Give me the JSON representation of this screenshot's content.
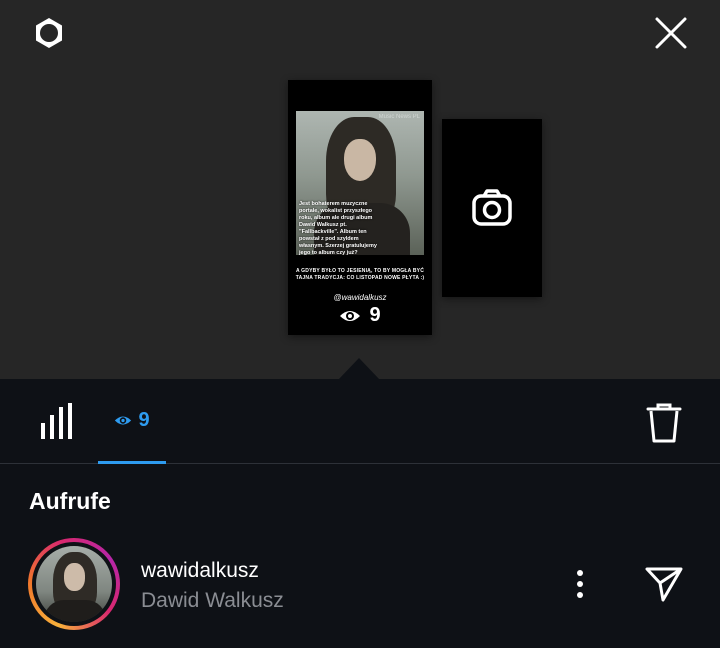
{
  "story": {
    "watermark": "Music News PL",
    "overlay_text": "Jest bohaterem muzyczne portale, wokalist przyszłego roku, album ale drugi album Dawid Walkusz pt. \"Fallbackville\". Album ten powstał z pod szyldem własnym. Szerzej gratulujemy jego to album czy już?",
    "caption": "A GDYBY BYŁO TO JESIENIĄ, TO BY MOGŁA BYĆ TAJNA TRADYCJA: CO LISTOPAD NOWE PŁYTA :)",
    "mention": "@wawidalkusz",
    "views": "9"
  },
  "tabs": {
    "viewers_count": "9"
  },
  "section_title": "Aufrufe",
  "viewer": {
    "username": "wawidalkusz",
    "full_name": "Dawid Walkusz"
  },
  "colors": {
    "accent": "#2e9cf0",
    "background_top": "#262626",
    "background_bottom": "#0e1116"
  }
}
